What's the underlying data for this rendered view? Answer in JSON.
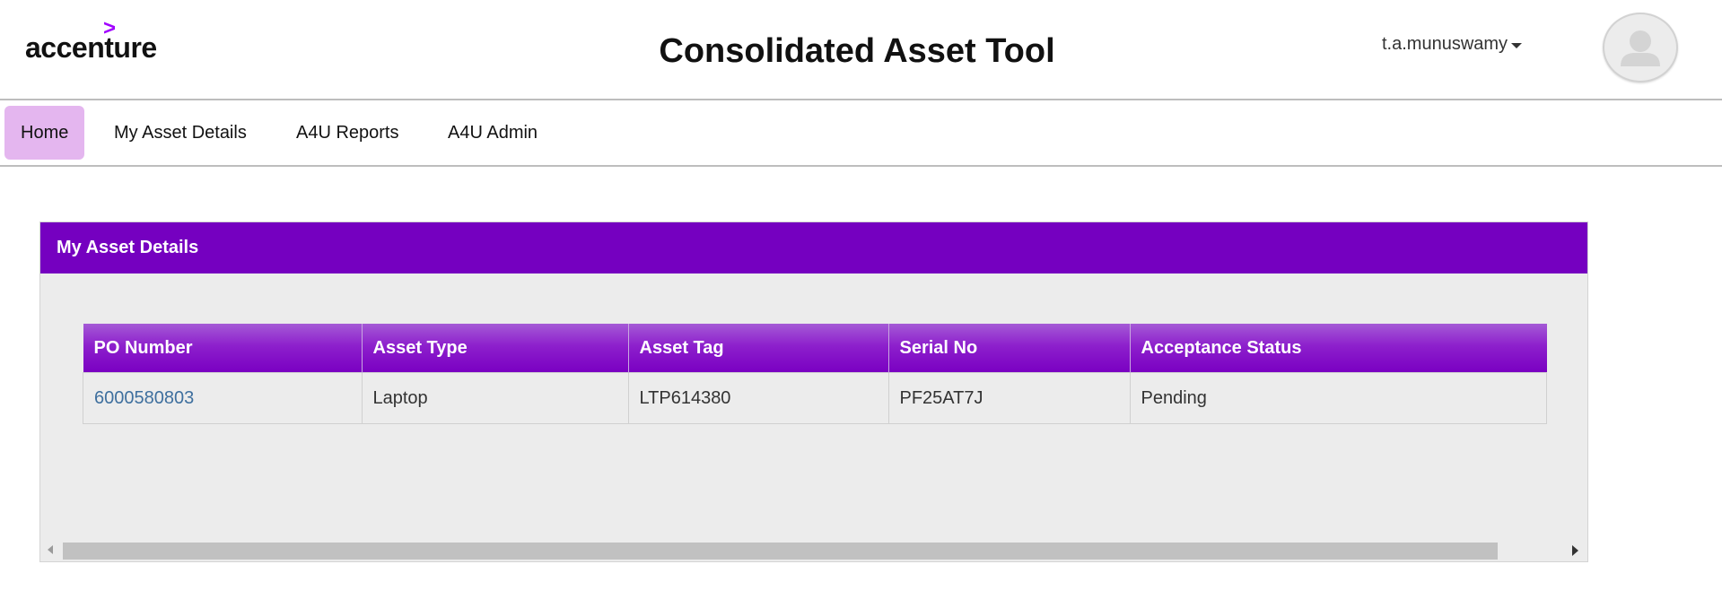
{
  "header": {
    "logo_mark": ">",
    "logo_text": "accenture",
    "title": "Consolidated Asset Tool",
    "username": "t.a.munuswamy"
  },
  "nav": {
    "items": [
      {
        "label": "Home",
        "active": true
      },
      {
        "label": "My Asset Details",
        "active": false
      },
      {
        "label": "A4U Reports",
        "active": false
      },
      {
        "label": "A4U Admin",
        "active": false
      }
    ]
  },
  "panel": {
    "title": "My Asset Details",
    "table": {
      "columns": [
        "PO Number",
        "Asset Type",
        "Asset Tag",
        "Serial No",
        "Acceptance Status"
      ],
      "rows": [
        [
          "6000580803",
          "Laptop",
          "LTP614380",
          "PF25AT7J",
          "Pending"
        ]
      ]
    }
  },
  "colors": {
    "brand_purple": "#7500c0",
    "logo_accent": "#a100ff",
    "active_nav": "#e4b6ef",
    "link": "#3e6f9e"
  },
  "icons": {
    "user_avatar": "user-silhouette-icon",
    "caret": "caret-down-icon"
  }
}
